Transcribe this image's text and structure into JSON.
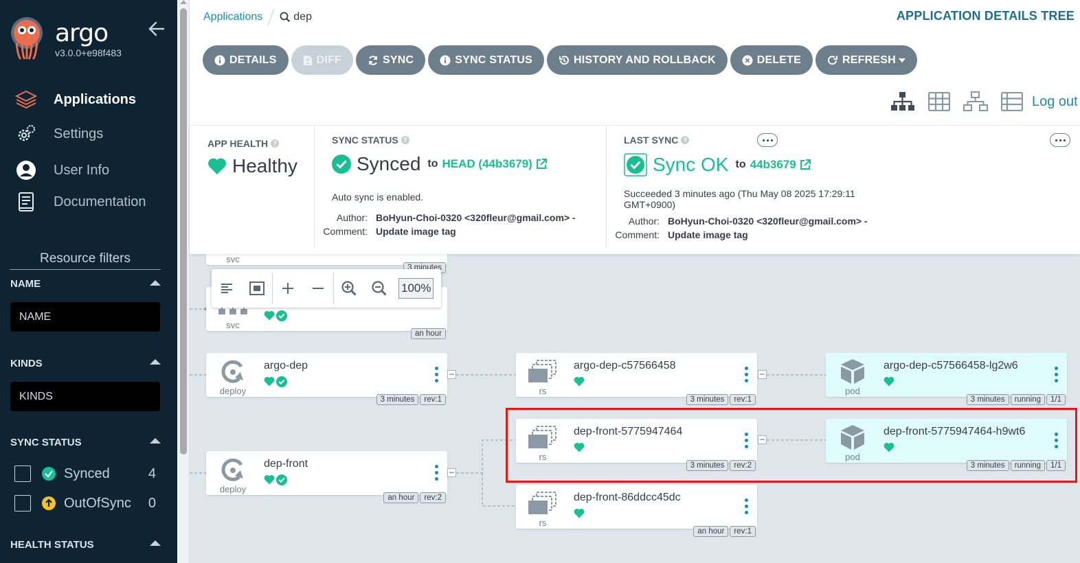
{
  "sidebar": {
    "brand": "argo",
    "version": "v3.0.0+e98f483",
    "nav": [
      {
        "label": "Applications",
        "icon": "layers-icon",
        "active": true
      },
      {
        "label": "Settings",
        "icon": "gears-icon",
        "active": false
      },
      {
        "label": "User Info",
        "icon": "user-circle-icon",
        "active": false
      },
      {
        "label": "Documentation",
        "icon": "book-icon",
        "active": false
      }
    ],
    "resource_filters_title": "Resource filters",
    "name_filter": {
      "title": "NAME",
      "placeholder": "NAME"
    },
    "kinds_filter": {
      "title": "KINDS",
      "placeholder": "KINDS"
    },
    "sync_status": {
      "title": "SYNC STATUS",
      "items": [
        {
          "label": "Synced",
          "count": "4",
          "color": "#18be94"
        },
        {
          "label": "OutOfSync",
          "count": "0",
          "color": "#f4c030"
        }
      ]
    },
    "health_status_title": "HEALTH STATUS"
  },
  "breadcrumb": {
    "root": "Applications",
    "current": "dep"
  },
  "page_title": "APPLICATION DETAILS TREE",
  "toolbar": {
    "details": "DETAILS",
    "diff": "DIFF",
    "sync": "SYNC",
    "sync_status": "SYNC STATUS",
    "history": "HISTORY AND ROLLBACK",
    "delete": "DELETE",
    "refresh": "REFRESH"
  },
  "logout": "Log out",
  "app_health": {
    "title": "APP HEALTH",
    "status": "Healthy",
    "color": "#18be94"
  },
  "sync_status_panel": {
    "title": "SYNC STATUS",
    "status": "Synced",
    "to": "to",
    "revision": "HEAD (44b3679)",
    "auto_sync": "Auto sync is enabled.",
    "author_label": "Author:",
    "author": "BoHyun-Choi-0320 <320fleur@gmail.com> -",
    "comment_label": "Comment:",
    "comment": "Update image tag"
  },
  "last_sync_panel": {
    "title": "LAST SYNC",
    "status": "Sync OK",
    "to": "to",
    "revision": "44b3679",
    "succeeded": "Succeeded 3 minutes ago (Thu May 08 2025 17:29:11 GMT+0900)",
    "author_label": "Author:",
    "author": "BoHyun-Choi-0320 <320fleur@gmail.com> -",
    "comment_label": "Comment:",
    "comment": "Update image tag"
  },
  "zoom": {
    "value": "100%"
  },
  "graph": {
    "svc_top": {
      "kind": "svc",
      "tag": "3 minutes"
    },
    "svc2": {
      "kind": "svc",
      "tag": "an hour"
    },
    "nodes": {
      "argo_dep": {
        "name": "argo-dep",
        "kind": "deploy",
        "tags": [
          "3 minutes",
          "rev:1"
        ]
      },
      "argo_dep_rs": {
        "name": "argo-dep-c57566458",
        "kind": "rs",
        "tags": [
          "3 minutes",
          "rev:1"
        ]
      },
      "argo_dep_pod": {
        "name": "argo-dep-c57566458-lg2w6",
        "kind": "pod",
        "tags": [
          "3 minutes",
          "running",
          "1/1"
        ]
      },
      "dep_front": {
        "name": "dep-front",
        "kind": "deploy",
        "tags": [
          "an hour",
          "rev:2"
        ]
      },
      "dep_front_rs1": {
        "name": "dep-front-5775947464",
        "kind": "rs",
        "tags": [
          "3 minutes",
          "rev:2"
        ]
      },
      "dep_front_pod": {
        "name": "dep-front-5775947464-h9wt6",
        "kind": "pod",
        "tags": [
          "3 minutes",
          "running",
          "1/1"
        ]
      },
      "dep_front_rs2": {
        "name": "dep-front-86ddcc45dc",
        "kind": "rs",
        "tags": [
          "an hour",
          "rev:1"
        ]
      }
    }
  },
  "colors": {
    "sidebar_bg": "#0e2433",
    "accent": "#1e8ba8",
    "healthy": "#18be94",
    "highlight": "#e01b1b"
  }
}
